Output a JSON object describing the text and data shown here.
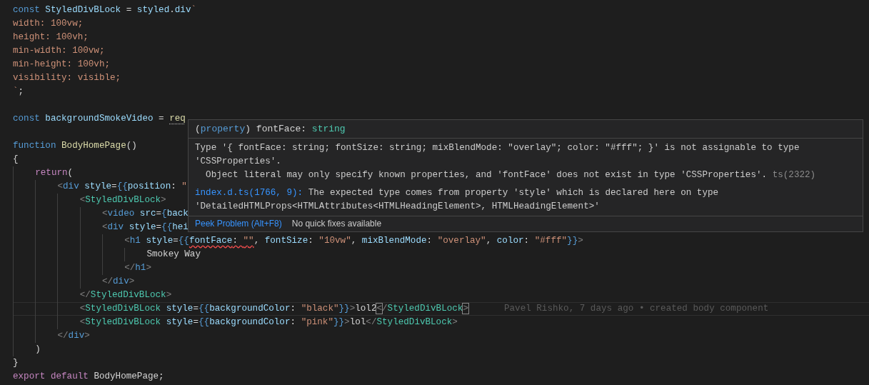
{
  "editor": {
    "blocks": [
      {
        "lines": [
          {
            "segments": [
              {
                "text": "const",
                "kind": "keyword"
              },
              {
                "text": " StyledDivBLock",
                "kind": "variable"
              },
              {
                "text": " = ",
                "kind": "plain"
              },
              {
                "text": "styled",
                "kind": "variable"
              },
              {
                "text": ".",
                "kind": "plain"
              },
              {
                "text": "div",
                "kind": "variable"
              },
              {
                "text": "`",
                "kind": "string"
              }
            ]
          },
          {
            "segments": [
              {
                "text": "width: 100vw;",
                "kind": "string"
              }
            ]
          },
          {
            "segments": [
              {
                "text": "height: 100vh;",
                "kind": "string"
              }
            ]
          },
          {
            "segments": [
              {
                "text": "min-width: 100vw;",
                "kind": "string"
              }
            ]
          },
          {
            "segments": [
              {
                "text": "min-height: 100vh;",
                "kind": "string"
              }
            ]
          },
          {
            "segments": [
              {
                "text": "visibility: visible;",
                "kind": "string"
              }
            ]
          },
          {
            "segments": [
              {
                "text": "`",
                "kind": "string"
              },
              {
                "text": ";",
                "kind": "plain"
              }
            ]
          }
        ]
      },
      {
        "lines": [
          {
            "segments": [
              {
                "text": "const",
                "kind": "keyword"
              },
              {
                "text": " backgroundSmokeVideo",
                "kind": "variable"
              },
              {
                "text": " = ",
                "kind": "plain"
              },
              {
                "text": "req",
                "kind": "function",
                "hint": true
              }
            ]
          }
        ]
      },
      {
        "lines": [
          {
            "segments": [
              {
                "text": "function",
                "kind": "keyword"
              },
              {
                "text": " BodyHomePage",
                "kind": "function"
              },
              {
                "text": "()",
                "kind": "plain"
              }
            ]
          },
          {
            "segments": [
              {
                "text": "{",
                "kind": "plain"
              }
            ]
          },
          {
            "segments": [
              {
                "text": "    return",
                "kind": "control"
              },
              {
                "text": "(",
                "kind": "plain"
              }
            ]
          },
          {
            "segments": [
              {
                "text": "        <",
                "kind": "bracket"
              },
              {
                "text": "div",
                "kind": "keyword"
              },
              {
                "text": " style",
                "kind": "variable"
              },
              {
                "text": "=",
                "kind": "plain"
              },
              {
                "text": "{{",
                "kind": "keyword"
              },
              {
                "text": "position",
                "kind": "variable"
              },
              {
                "text": ": ",
                "kind": "plain"
              },
              {
                "text": "\"",
                "kind": "string"
              }
            ]
          },
          {
            "segments": [
              {
                "text": "            <",
                "kind": "bracket"
              },
              {
                "text": "StyledDivBLock",
                "kind": "component"
              },
              {
                "text": ">",
                "kind": "bracket"
              }
            ]
          },
          {
            "segments": [
              {
                "text": "                <",
                "kind": "bracket"
              },
              {
                "text": "video",
                "kind": "keyword"
              },
              {
                "text": " src",
                "kind": "variable"
              },
              {
                "text": "=",
                "kind": "plain"
              },
              {
                "text": "{",
                "kind": "keyword"
              },
              {
                "text": "back",
                "kind": "variable"
              }
            ]
          },
          {
            "segments": [
              {
                "text": "                <",
                "kind": "bracket"
              },
              {
                "text": "div",
                "kind": "keyword"
              },
              {
                "text": " style",
                "kind": "variable"
              },
              {
                "text": "=",
                "kind": "plain"
              },
              {
                "text": "{{",
                "kind": "keyword"
              },
              {
                "text": "hei",
                "kind": "variable"
              }
            ]
          },
          {
            "segments": [
              {
                "text": "                    <",
                "kind": "bracket"
              },
              {
                "text": "h1",
                "kind": "keyword"
              },
              {
                "text": " style",
                "kind": "variable"
              },
              {
                "text": "=",
                "kind": "plain"
              },
              {
                "text": "{{",
                "kind": "keyword"
              },
              {
                "text": "fontFace",
                "kind": "variable",
                "error": true
              },
              {
                "text": ": ",
                "kind": "plain",
                "error": true
              },
              {
                "text": "\"\"",
                "kind": "string",
                "error": true
              },
              {
                "text": ", ",
                "kind": "plain"
              },
              {
                "text": "fontSize",
                "kind": "variable"
              },
              {
                "text": ": ",
                "kind": "plain"
              },
              {
                "text": "\"10vw\"",
                "kind": "string"
              },
              {
                "text": ", ",
                "kind": "plain"
              },
              {
                "text": "mixBlendMode",
                "kind": "variable"
              },
              {
                "text": ": ",
                "kind": "plain"
              },
              {
                "text": "\"overlay\"",
                "kind": "string"
              },
              {
                "text": ", ",
                "kind": "plain"
              },
              {
                "text": "color",
                "kind": "variable"
              },
              {
                "text": ": ",
                "kind": "plain"
              },
              {
                "text": "\"#fff\"",
                "kind": "string"
              },
              {
                "text": "}}",
                "kind": "keyword"
              },
              {
                "text": ">",
                "kind": "bracket"
              }
            ]
          },
          {
            "segments": [
              {
                "text": "                        Smokey Way",
                "kind": "plain"
              }
            ]
          },
          {
            "segments": [
              {
                "text": "                    </",
                "kind": "bracket"
              },
              {
                "text": "h1",
                "kind": "keyword"
              },
              {
                "text": ">",
                "kind": "bracket"
              }
            ]
          },
          {
            "segments": [
              {
                "text": "                </",
                "kind": "bracket"
              },
              {
                "text": "div",
                "kind": "keyword"
              },
              {
                "text": ">",
                "kind": "bracket"
              }
            ]
          },
          {
            "segments": [
              {
                "text": "            </",
                "kind": "bracket"
              },
              {
                "text": "StyledDivBLock",
                "kind": "component"
              },
              {
                "text": ">",
                "kind": "bracket"
              }
            ]
          },
          {
            "current": true,
            "blame": "Pavel Rishko, 7 days ago • created body component",
            "segments": [
              {
                "text": "            <",
                "kind": "bracket"
              },
              {
                "text": "StyledDivBLock",
                "kind": "component"
              },
              {
                "text": " style",
                "kind": "variable"
              },
              {
                "text": "=",
                "kind": "plain"
              },
              {
                "text": "{{",
                "kind": "keyword"
              },
              {
                "text": "backgroundColor",
                "kind": "variable"
              },
              {
                "text": ": ",
                "kind": "plain"
              },
              {
                "text": "\"black\"",
                "kind": "string"
              },
              {
                "text": "}}",
                "kind": "keyword"
              },
              {
                "text": ">",
                "kind": "bracket"
              },
              {
                "text": "lol2",
                "kind": "plain"
              },
              {
                "text": "<",
                "kind": "bracket",
                "match": true
              },
              {
                "text": "/",
                "kind": "bracket"
              },
              {
                "text": "StyledDivBLock",
                "kind": "component"
              },
              {
                "text": ">",
                "kind": "bracket",
                "match": true
              }
            ]
          },
          {
            "segments": [
              {
                "text": "            <",
                "kind": "bracket"
              },
              {
                "text": "StyledDivBLock",
                "kind": "component"
              },
              {
                "text": " style",
                "kind": "variable"
              },
              {
                "text": "=",
                "kind": "plain"
              },
              {
                "text": "{{",
                "kind": "keyword"
              },
              {
                "text": "backgroundColor",
                "kind": "variable"
              },
              {
                "text": ": ",
                "kind": "plain"
              },
              {
                "text": "\"pink\"",
                "kind": "string"
              },
              {
                "text": "}}",
                "kind": "keyword"
              },
              {
                "text": ">",
                "kind": "bracket"
              },
              {
                "text": "lol",
                "kind": "plain"
              },
              {
                "text": "</",
                "kind": "bracket"
              },
              {
                "text": "StyledDivBLock",
                "kind": "component"
              },
              {
                "text": ">",
                "kind": "bracket"
              }
            ]
          },
          {
            "segments": [
              {
                "text": "        </",
                "kind": "bracket"
              },
              {
                "text": "div",
                "kind": "keyword"
              },
              {
                "text": ">",
                "kind": "bracket"
              }
            ]
          },
          {
            "segments": [
              {
                "text": "    )",
                "kind": "plain"
              }
            ]
          },
          {
            "segments": [
              {
                "text": "}",
                "kind": "plain"
              }
            ]
          },
          {
            "segments": [
              {
                "text": "export",
                "kind": "control"
              },
              {
                "text": " default",
                "kind": "control"
              },
              {
                "text": " BodyHomePage",
                "kind": "plain"
              },
              {
                "text": ";",
                "kind": "plain"
              }
            ]
          }
        ]
      }
    ]
  },
  "hover": {
    "signature": [
      {
        "text": "(",
        "kind": "plain"
      },
      {
        "text": "property",
        "kind": "keyword"
      },
      {
        "text": ") fontFace: ",
        "kind": "plain"
      },
      {
        "text": "string",
        "kind": "type"
      }
    ],
    "message": "Type '{ fontFace: string; fontSize: string; mixBlendMode: \"overlay\"; color: \"#fff\"; }' is not assignable to type 'CSSProperties'.",
    "detail": "Object literal may only specify known properties, and 'fontFace' does not exist in type 'CSSProperties'.",
    "code": "ts(2322)",
    "related_location": "index.d.ts(1766, 9):",
    "related_message": "The expected type comes from property 'style' which is declared here on type 'DetailedHTMLProps<HTMLAttributes<HTMLHeadingElement>, HTMLHeadingElement>'",
    "peek_action": "Peek Problem (Alt+F8)",
    "quick_fix_note": "No quick fixes available"
  }
}
